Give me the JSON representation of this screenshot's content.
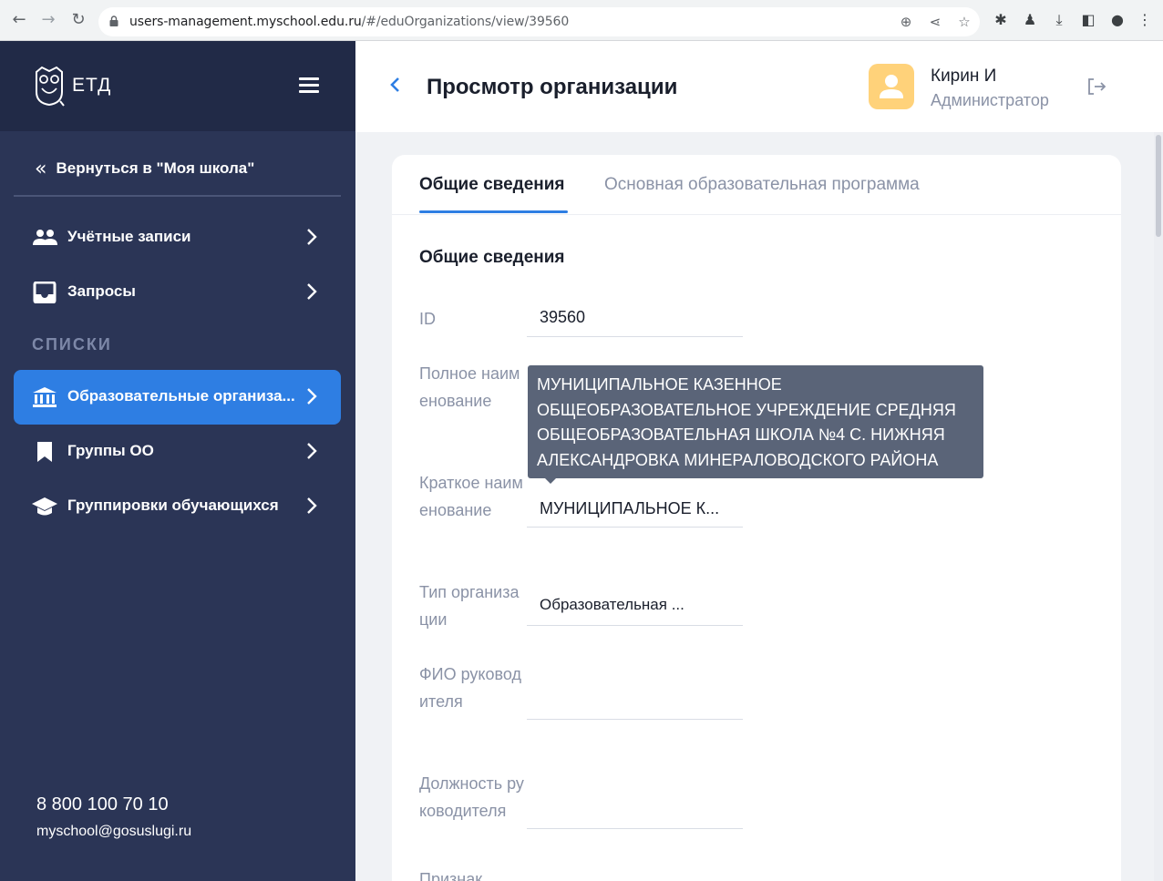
{
  "browser": {
    "url_host": "users-management.myschool.edu.ru",
    "url_path": "/#/eduOrganizations/view/39560"
  },
  "sidebar": {
    "logo_text": "ЕТД",
    "back_label": "Вернуться в \"Моя школа\"",
    "items_top": [
      {
        "label": "Учётные записи",
        "icon": "people-icon"
      },
      {
        "label": "Запросы",
        "icon": "inbox-icon"
      }
    ],
    "section_label": "СПИСКИ",
    "items_lists": [
      {
        "label": "Образовательные организа...",
        "icon": "institution-icon",
        "active": true
      },
      {
        "label": "Группы ОО",
        "icon": "bookmark-icon"
      },
      {
        "label": "Группировки обучающихся",
        "icon": "graduation-cap-icon"
      }
    ],
    "phone": "8 800 100 70 10",
    "email": "myschool@gosuslugi.ru"
  },
  "header": {
    "title": "Просмотр организации",
    "user_name": "Кирин И",
    "user_role": "Администратор"
  },
  "tabs": [
    {
      "label": "Общие сведения",
      "active": true
    },
    {
      "label": "Основная образовательная программа",
      "active": false
    }
  ],
  "section_title": "Общие сведения",
  "fields": [
    {
      "label": "ID",
      "value": "39560"
    },
    {
      "label": "Полное наименование",
      "value": ""
    },
    {
      "label": "Краткое наименование",
      "value": "МУНИЦИПАЛЬНОЕ К..."
    },
    {
      "label": "Тип организации",
      "value": "Образовательная ..."
    },
    {
      "label": "ФИО руководителя",
      "value": ""
    },
    {
      "label": "Должность руководителя",
      "value": ""
    },
    {
      "label": "Признак",
      "value": ""
    }
  ],
  "tooltip": {
    "text": "МУНИЦИПАЛЬНОЕ КАЗЕННОЕ ОБЩЕОБРАЗОВАТЕЛЬНОЕ УЧРЕЖДЕНИЕ СРЕДНЯЯ ОБЩЕОБРАЗОВАТЕЛЬНАЯ ШКОЛА №4 С. НИЖНЯЯ АЛЕКСАНДРОВКА МИНЕРАЛОВОДСКОГО РАЙОНА"
  },
  "colors": {
    "sidebar_bg": "#2b3556",
    "sidebar_top_bg": "#212a47",
    "accent": "#2e7ee3",
    "tooltip_bg": "#5a6478",
    "avatar_bg": "#ffd27a"
  }
}
